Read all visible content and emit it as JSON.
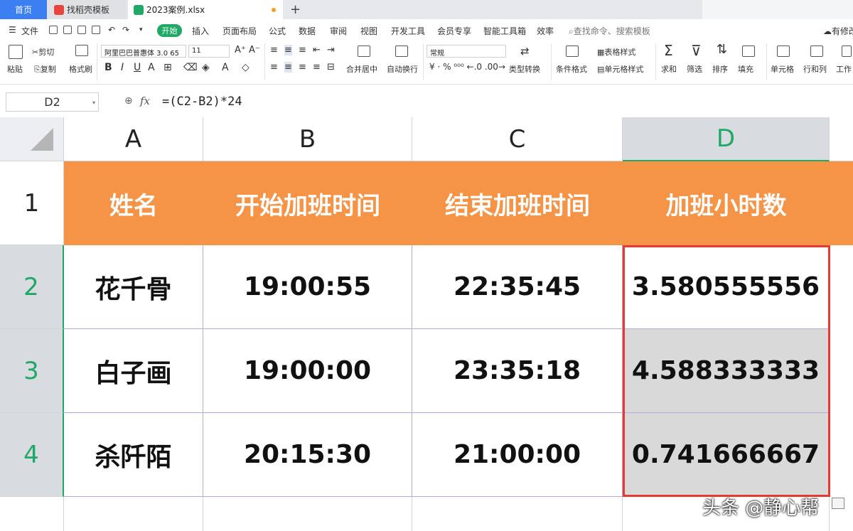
{
  "tabs": [
    {
      "label": "首页"
    },
    {
      "label": "找稻壳模板"
    },
    {
      "label": "2023案例.xlsx"
    }
  ],
  "menu": {
    "file": "文件",
    "start": "开始",
    "items": [
      "插入",
      "页面布局",
      "公式",
      "数据",
      "审阅",
      "视图",
      "开发工具",
      "会员专享",
      "智能工具箱",
      "效率"
    ],
    "search": "查找命令、搜索模板",
    "right": "有修改"
  },
  "ribbon": {
    "paste": "粘贴",
    "cut": "剪切",
    "copy": "复制",
    "format_painter": "格式刷",
    "font_name": "阿里巴巴普惠体 3.0 65",
    "font_size": "11",
    "merge_center": "合并居中",
    "auto_wrap": "自动换行",
    "number_format": "常规",
    "type_convert": "类型转换",
    "cond_format": "条件格式",
    "table_style": "表格样式",
    "cell_style": "单元格样式",
    "sum": "求和",
    "filter": "筛选",
    "sort": "排序",
    "fill": "填充",
    "cell": "单元格",
    "row_col": "行和列",
    "worksheet": "工作"
  },
  "formula_bar": {
    "cell_ref": "D2",
    "formula": "=(C2-B2)*24"
  },
  "sheet": {
    "columns": [
      "A",
      "B",
      "C",
      "D"
    ],
    "rows": [
      "1",
      "2",
      "3",
      "4"
    ],
    "header": [
      "姓名",
      "开始加班时间",
      "结束加班时间",
      "加班小时数"
    ],
    "data": [
      [
        "花千骨",
        "19:00:55",
        "22:35:45",
        "3.580555556"
      ],
      [
        "白子画",
        "19:00:00",
        "23:35:18",
        "4.588333333"
      ],
      [
        "杀阡陌",
        "20:15:30",
        "21:00:00",
        "0.741666667"
      ]
    ]
  },
  "watermark": "头条 @静心帮",
  "colors": {
    "header_fill": "#f59446",
    "accent_green": "#1fa866",
    "selection_border": "#e53935",
    "tab_active": "#3b7ff3"
  }
}
